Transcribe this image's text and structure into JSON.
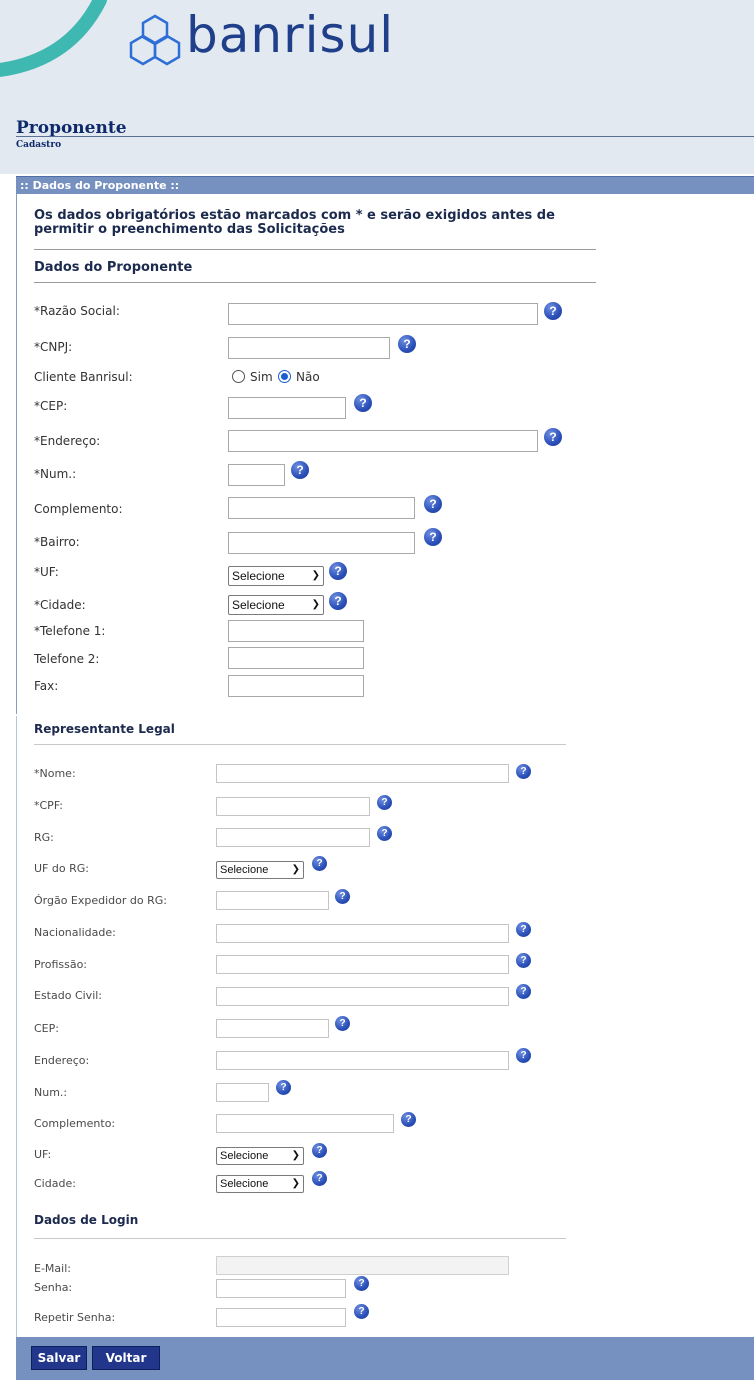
{
  "brand": {
    "name": "banrisul"
  },
  "page": {
    "title": "Proponente",
    "subtitle": "Cadastro"
  },
  "section_title": ":: Dados do Proponente ::",
  "notice": "Os dados obrigatórios estão marcados com * e serão exigidos antes de permitir o preenchimento das Solicitações",
  "proponente": {
    "heading": "Dados do Proponente",
    "razao_social": {
      "label": "*Razão Social:",
      "value": ""
    },
    "cnpj": {
      "label": "*CNPJ:",
      "value": ""
    },
    "cliente_banrisul": {
      "label": "Cliente Banrisul:",
      "option_sim": "Sim",
      "option_nao": "Não",
      "selected": "Não"
    },
    "cep": {
      "label": "*CEP:",
      "value": ""
    },
    "endereco": {
      "label": "*Endereço:",
      "value": ""
    },
    "num": {
      "label": "*Num.:",
      "value": ""
    },
    "complemento": {
      "label": "Complemento:",
      "value": ""
    },
    "bairro": {
      "label": "*Bairro:",
      "value": ""
    },
    "uf": {
      "label": "*UF:",
      "selected": "Selecione"
    },
    "cidade": {
      "label": "*Cidade:",
      "selected": "Selecione"
    },
    "telefone1": {
      "label": "*Telefone 1:",
      "value": ""
    },
    "telefone2": {
      "label": "Telefone 2:",
      "value": ""
    },
    "fax": {
      "label": "Fax:",
      "value": ""
    }
  },
  "representante": {
    "heading": "Representante Legal",
    "nome": {
      "label": "*Nome:",
      "value": ""
    },
    "cpf": {
      "label": "*CPF:",
      "value": ""
    },
    "rg": {
      "label": "RG:",
      "value": ""
    },
    "uf_rg": {
      "label": "UF do RG:",
      "selected": "Selecione"
    },
    "orgao_expedidor": {
      "label": "Órgão Expedidor do RG:",
      "value": ""
    },
    "nacionalidade": {
      "label": "Nacionalidade:",
      "value": ""
    },
    "profissao": {
      "label": "Profissão:",
      "value": ""
    },
    "estado_civil": {
      "label": "Estado Civil:",
      "value": ""
    },
    "cep": {
      "label": "CEP:",
      "value": ""
    },
    "endereco": {
      "label": "Endereço:",
      "value": ""
    },
    "num": {
      "label": "Num.:",
      "value": ""
    },
    "complemento": {
      "label": "Complemento:",
      "value": ""
    },
    "uf": {
      "label": "UF:",
      "selected": "Selecione"
    },
    "cidade": {
      "label": "Cidade:",
      "selected": "Selecione"
    }
  },
  "login": {
    "heading": "Dados de Login",
    "email": {
      "label": "E-Mail:",
      "value": ""
    },
    "senha": {
      "label": "Senha:",
      "value": ""
    },
    "repetir_senha": {
      "label": "Repetir Senha:",
      "value": ""
    }
  },
  "buttons": {
    "salvar": "Salvar",
    "voltar": "Voltar"
  },
  "icons": {
    "help": "help-icon",
    "logo": "banrisul-logo-icon",
    "select_arrow": "chevron-down-icon"
  },
  "colors": {
    "header_bg": "#e3e9f1",
    "section_bar": "#7690c0",
    "button": "#22368c",
    "brand_text": "#1f3f8a",
    "brand_accent": "#3fb8b2"
  }
}
